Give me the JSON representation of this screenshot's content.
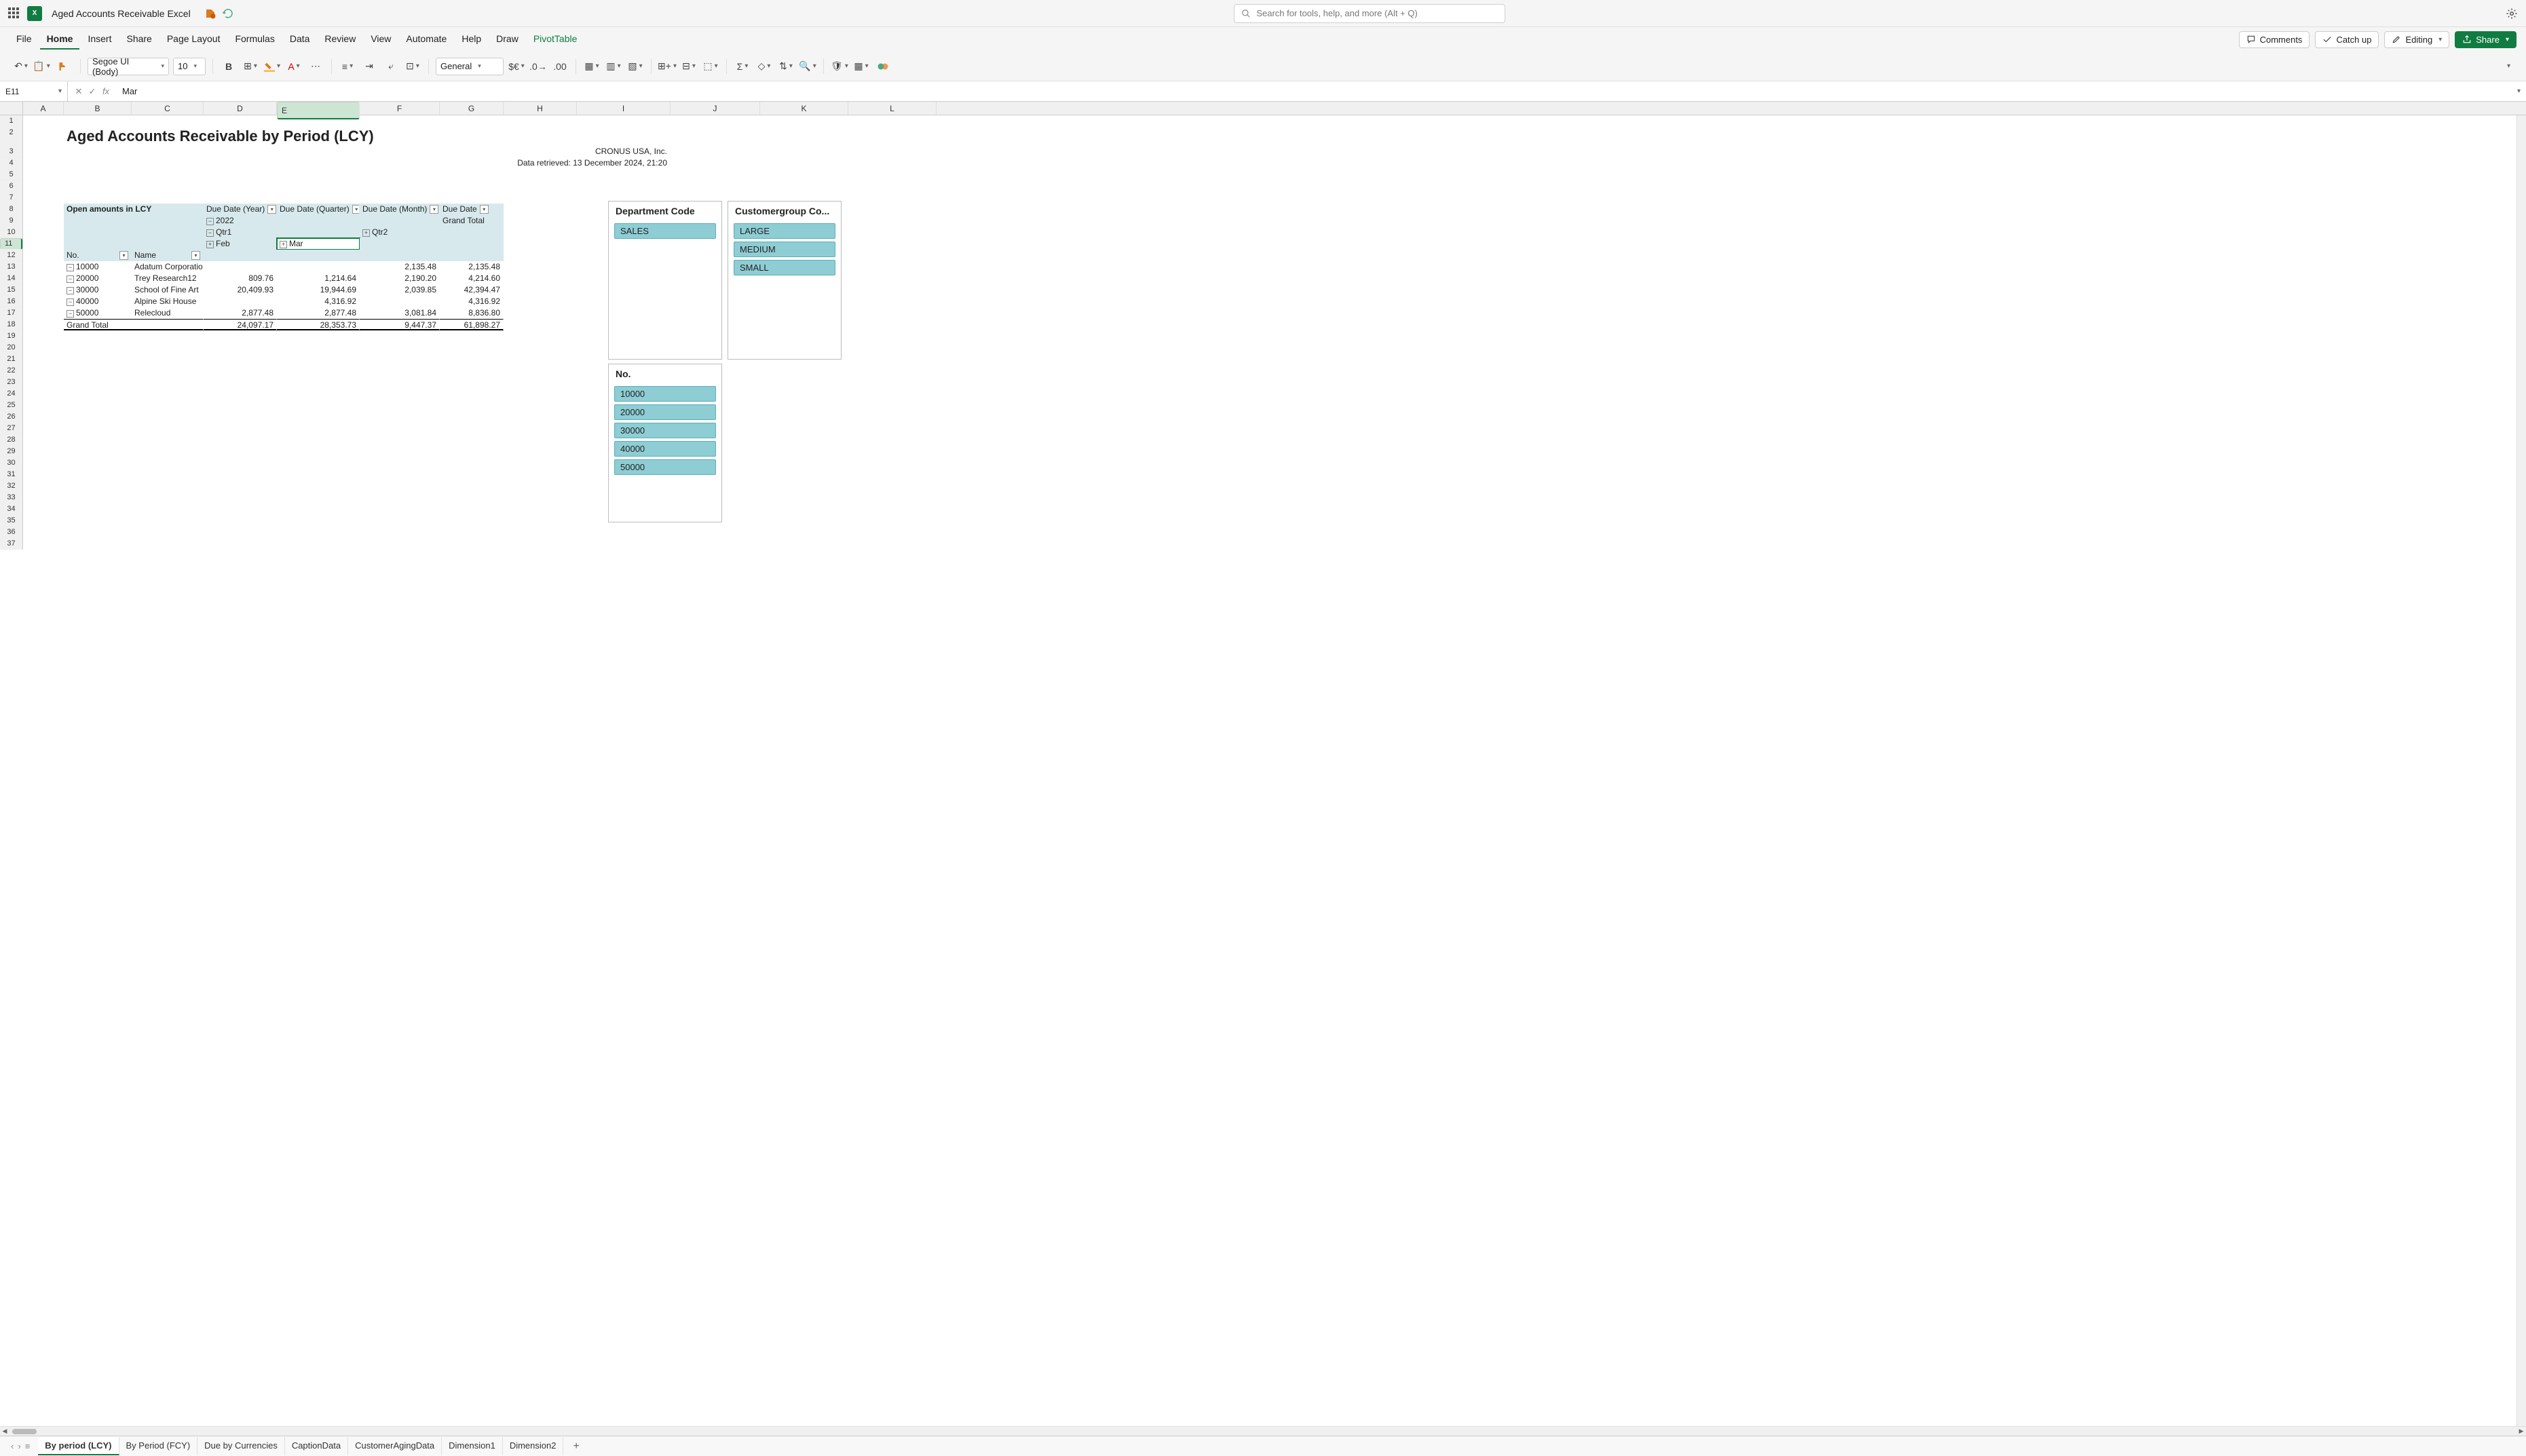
{
  "titlebar": {
    "doc_title": "Aged Accounts Receivable Excel",
    "search_placeholder": "Search for tools, help, and more (Alt + Q)"
  },
  "ribbon": {
    "tabs": [
      "File",
      "Home",
      "Insert",
      "Share",
      "Page Layout",
      "Formulas",
      "Data",
      "Review",
      "View",
      "Automate",
      "Help",
      "Draw",
      "PivotTable"
    ],
    "active": "Home",
    "comments": "Comments",
    "catchup": "Catch up",
    "editing": "Editing",
    "share": "Share"
  },
  "toolbar": {
    "font": "Segoe UI (Body)",
    "font_size": "10",
    "number_format": "General"
  },
  "formula": {
    "name_box": "E11",
    "value": "Mar"
  },
  "columns": [
    "A",
    "B",
    "C",
    "D",
    "E",
    "F",
    "G",
    "H",
    "I",
    "J",
    "K",
    "L"
  ],
  "report": {
    "title": "Aged Accounts Receivable by Period (LCY)",
    "company": "CRONUS USA, Inc.",
    "retrieved": "Data retrieved: 13 December 2024, 21:20",
    "header_label": "Open amounts in LCY",
    "col_headers": {
      "year": "Due Date (Year)",
      "quarter": "Due Date (Quarter)",
      "month": "Due Date (Month)",
      "due_date": "Due Date",
      "grand_total": "Grand Total"
    },
    "year_val": "2022",
    "q1": "Qtr1",
    "q2": "Qtr2",
    "feb": "Feb",
    "mar": "Mar",
    "row_headers": {
      "no": "No.",
      "name": "Name",
      "grand_total": "Grand Total"
    },
    "rows": [
      {
        "no": "10000",
        "name": "Adatum Corporation",
        "feb": "",
        "mar": "",
        "q2": "2,135.48",
        "total": "2,135.48"
      },
      {
        "no": "20000",
        "name": "Trey Research12",
        "feb": "809.76",
        "mar": "1,214.64",
        "q2": "2,190.20",
        "total": "4,214.60"
      },
      {
        "no": "30000",
        "name": "School of Fine Art",
        "feb": "20,409.93",
        "mar": "19,944.69",
        "q2": "2,039.85",
        "total": "42,394.47"
      },
      {
        "no": "40000",
        "name": "Alpine Ski House",
        "feb": "",
        "mar": "4,316.92",
        "q2": "",
        "total": "4,316.92"
      },
      {
        "no": "50000",
        "name": "Relecloud",
        "feb": "2,877.48",
        "mar": "2,877.48",
        "q2": "3,081.84",
        "total": "8,836.80"
      }
    ],
    "totals": {
      "feb": "24,097.17",
      "mar": "28,353.73",
      "q2": "9,447.37",
      "total": "61,898.27"
    }
  },
  "slicers": {
    "dept": {
      "title": "Department Code",
      "items": [
        "SALES"
      ]
    },
    "custgrp": {
      "title": "Customergroup Co...",
      "items": [
        "LARGE",
        "MEDIUM",
        "SMALL"
      ]
    },
    "no": {
      "title": "No.",
      "items": [
        "10000",
        "20000",
        "30000",
        "40000",
        "50000"
      ]
    }
  },
  "sheets": {
    "tabs": [
      "By period (LCY)",
      "By Period (FCY)",
      "Due by Currencies",
      "CaptionData",
      "CustomerAgingData",
      "Dimension1",
      "Dimension2"
    ],
    "active": "By period (LCY)"
  }
}
